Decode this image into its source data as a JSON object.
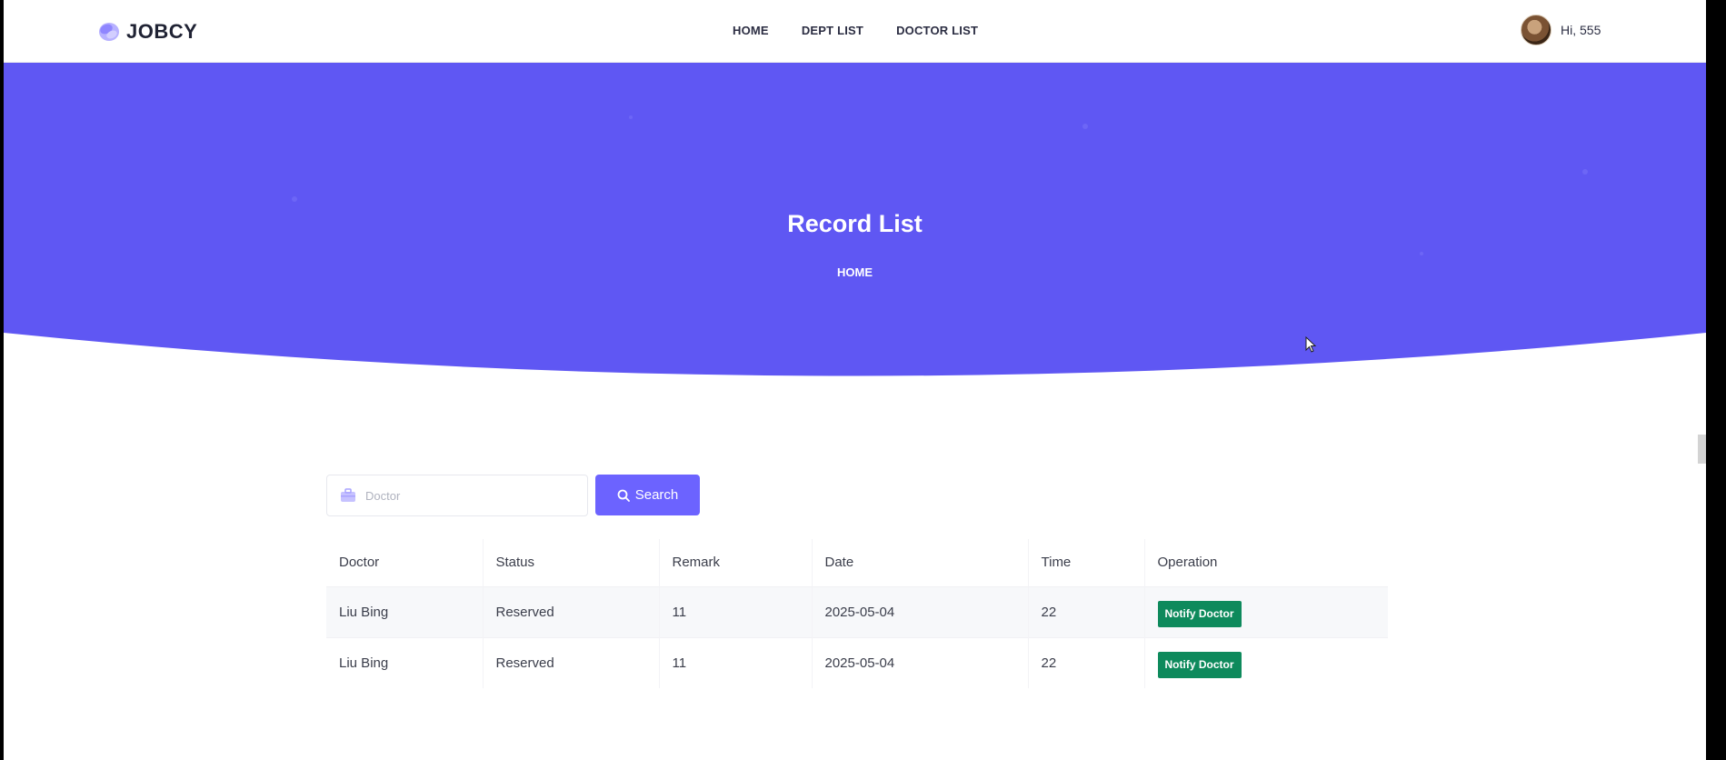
{
  "brand": {
    "name": "JOBCY",
    "logo_icon": "blob-logo-icon",
    "accent": "#b7b1ff"
  },
  "nav": {
    "links": [
      {
        "label": "HOME"
      },
      {
        "label": "DEPT LIST"
      },
      {
        "label": "DOCTOR LIST"
      }
    ]
  },
  "user": {
    "greeting": "Hi, 555",
    "avatar_icon": "user-avatar"
  },
  "hero": {
    "title": "Record List",
    "breadcrumb": "HOME",
    "color": "#5f57f3"
  },
  "search": {
    "placeholder": "Doctor",
    "value": "",
    "field_icon": "briefcase-icon",
    "button_label": "Search",
    "button_icon": "magnifier-icon",
    "button_color": "#6c63ff"
  },
  "table": {
    "columns": [
      "Doctor",
      "Status",
      "Remark",
      "Date",
      "Time",
      "Operation"
    ],
    "rows": [
      {
        "doctor": "Liu Bing",
        "status": "Reserved",
        "remark": "11",
        "date": "2025-05-04",
        "time": "22",
        "action": "Notify Doctor"
      },
      {
        "doctor": "Liu Bing",
        "status": "Reserved",
        "remark": "11",
        "date": "2025-05-04",
        "time": "22",
        "action": "Notify Doctor"
      }
    ],
    "action_color": "#0e8a5c"
  }
}
